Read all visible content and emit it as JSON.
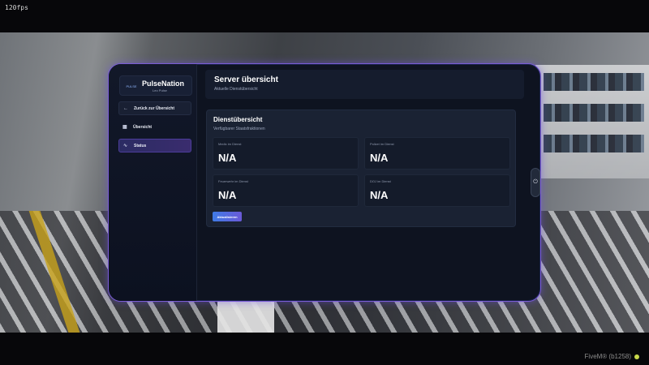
{
  "overlay": {
    "fps": "120fps",
    "client": "FiveM® (b1258)"
  },
  "brand": {
    "logo_text": "PULSE",
    "title": "PulseNation",
    "subtitle": "Leo Pulse"
  },
  "sidebar": {
    "items": [
      {
        "label": "Zurück zur Übersicht",
        "icon": "arrow-left-icon"
      },
      {
        "label": "Übersicht",
        "icon": "grid-icon"
      },
      {
        "label": "Status",
        "icon": "activity-icon",
        "active": true
      }
    ]
  },
  "header": {
    "title": "Server übersicht",
    "subtitle": "Aktuelle Dienstübersicht"
  },
  "panel": {
    "title": "Dienstübersicht",
    "subtitle": "Verfügbarer Staatsfraktionen",
    "stats": [
      {
        "label": "Medic im Dienst",
        "value": "N/A"
      },
      {
        "label": "Polizei im Dienst",
        "value": "N/A"
      },
      {
        "label": "Feuerwehr im Dienst",
        "value": "N/A"
      },
      {
        "label": "DOJ im Dienst",
        "value": "N/A"
      }
    ],
    "refresh_label": "Aktualisieren"
  },
  "colors": {
    "accent_border": "#7a5cd6",
    "active_nav": "#3a2c6e",
    "button_gradient_start": "#3f7be6",
    "button_gradient_end": "#6a5ad8"
  },
  "icons": {
    "power": "power-icon"
  }
}
